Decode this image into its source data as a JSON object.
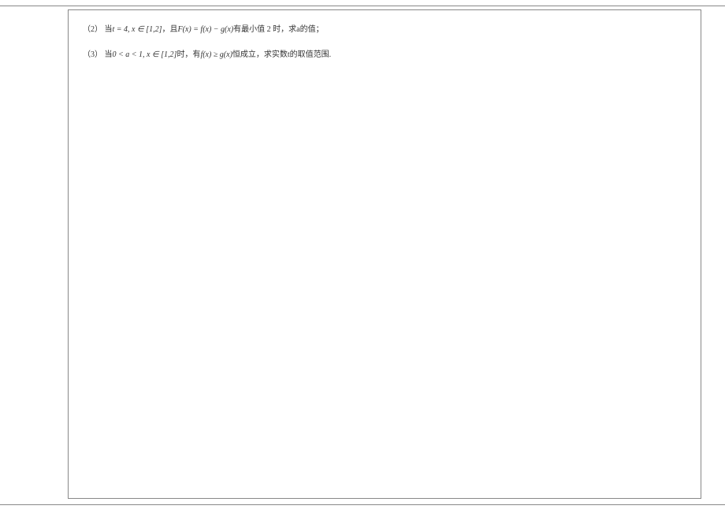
{
  "problems": {
    "p2": {
      "label": "（2）",
      "text_before_cond": "当",
      "condition": "t = 4, x ∈ [1,2]",
      "text_after_cond": "，且",
      "formula": "F(x) = f(x) − g(x)",
      "text_tail": "有最小值 2 时，求a的值；"
    },
    "p3": {
      "label": "（3）",
      "text_before_cond": "当",
      "condition": "0 < a < 1, x ∈ [1,2]",
      "text_mid": "时，有",
      "formula": "f(x) ≥ g(x)",
      "text_tail": "恒成立，求实数t的取值范围."
    }
  }
}
